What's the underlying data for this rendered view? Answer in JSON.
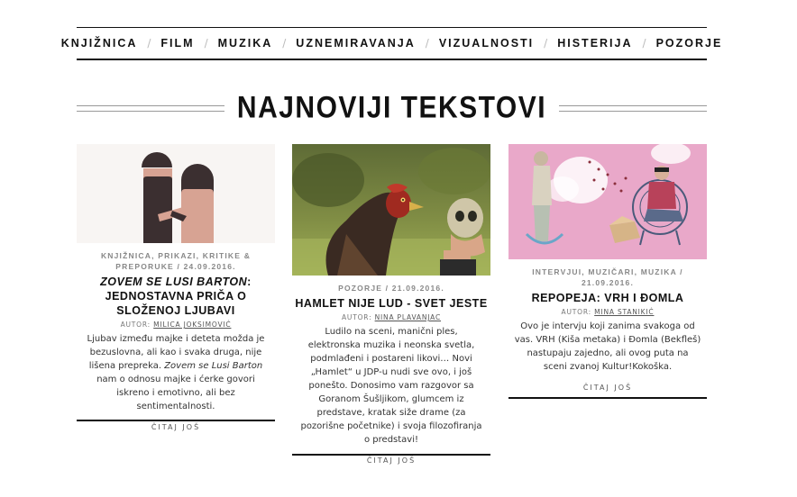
{
  "nav": {
    "items": [
      "KNJIŽNICA",
      "FILM",
      "MUZIKA",
      "UZNEMIRAVANJA",
      "VIZUALNOSTI",
      "HISTERIJA",
      "POZORJE"
    ],
    "separator": "/"
  },
  "section": {
    "title": "NAJNOVIJI TEKSTOVI"
  },
  "posts": [
    {
      "meta": "KNJIŽNICA, PRIKAZI, KRITIKE & PREPORUKE / 24.09.2016.",
      "title_italic": "ZOVEM SE LUSI BARTON",
      "title_rest": ": JEDNOSTAVNA PRIČA O SLOŽENOJ LJUBAVI",
      "author_label": "AUTOR:",
      "author": "MILICA JOKSIMOVIĆ",
      "excerpt_before": "Ljubav između majke i deteta možda je bezuslovna, ali kao i svaka druga, nije lišena prepreka. ",
      "excerpt_italic": "Zovem se Lusi Barton",
      "excerpt_after": " nam o odnosu majke i ćerke govori iskreno i emotivno, ali bez sentimentalnosti.",
      "more": "ČITAJ JOŠ",
      "image": "two-figures-illustration"
    },
    {
      "meta": "POZORJE / 21.09.2016.",
      "title": "HAMLET NIJE LUD - SVET JESTE",
      "author_label": "AUTOR:",
      "author": "NINA PLAVANJAC",
      "excerpt": "Ludilo na sceni, manični ples, elektronska muzika i neonska svetla, podmlađeni i postareni likovi… Novi „Hamlet“ u JDP-u nudi sve ovo, i još ponešto. Donosimo vam razgovor sa Goranom Šušljikom, glumcem iz predstave, kratak siže drame (za pozorišne početnike) i svoja filozofiranja o predstavi!",
      "more": "ČITAJ JOŠ",
      "image": "rooster-with-skull-photo"
    },
    {
      "meta": "INTERVJUI, MUZIČARI, MUZIKA / 21.09.2016.",
      "title": "REPOPEJA: VRH I ĐOMLA",
      "author_label": "AUTOR:",
      "author": "MINA STANIKIĆ",
      "excerpt": "Ovo je intervju koji zanima svakoga od vas. VRH (Kiša metaka) i Đomla (Bekfleš) nastupaju zajedno, ali ovog puta na sceni zvanoj Kultur!Kokoška.",
      "more": "ČITAJ JOŠ",
      "image": "pink-collage-illustration"
    }
  ],
  "colors": {
    "text": "#111111",
    "meta": "#888888",
    "pink": "#e8a6c8",
    "figure_dark": "#3a2e2e",
    "figure_skin": "#d9a89a"
  }
}
